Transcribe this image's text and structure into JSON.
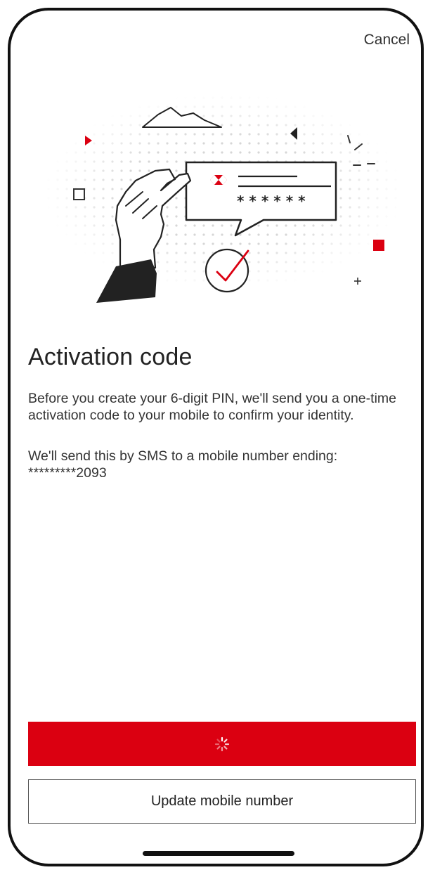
{
  "header": {
    "cancel_label": "Cancel"
  },
  "illustration": {
    "masked_digits": "* * * * * *",
    "brand_color": "#db0011"
  },
  "content": {
    "title": "Activation code",
    "paragraph_1": "Before you create your 6-digit PIN, we'll send you a one-time activation code to your mobile to confirm your identity.",
    "paragraph_2": "We'll send this by SMS to a mobile number ending: *********2093"
  },
  "actions": {
    "primary_state": "loading",
    "primary_icon": "spinner-icon",
    "update_label": "Update mobile number"
  },
  "colors": {
    "accent": "#db0011",
    "text": "#333333"
  }
}
